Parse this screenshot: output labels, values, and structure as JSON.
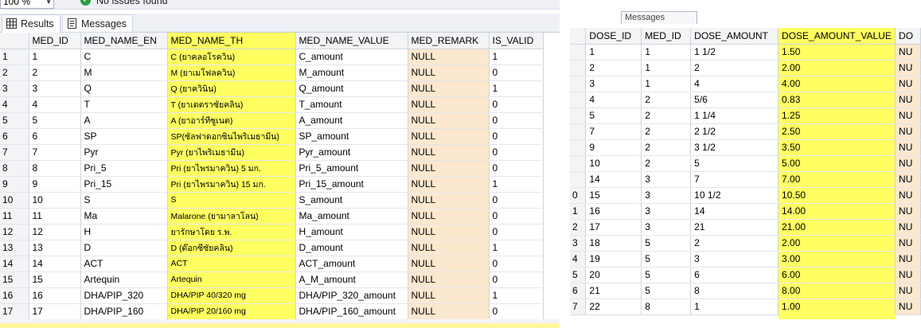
{
  "toolbar": {
    "zoom": "100 %",
    "issues": "No issues found"
  },
  "tabs": {
    "results": "Results",
    "messages": "Messages"
  },
  "left_grid": {
    "columns": [
      "MED_ID",
      "MED_NAME_EN",
      "MED_NAME_TH",
      "MED_NAME_VALUE",
      "MED_REMARK",
      "IS_VALID"
    ],
    "rows": [
      [
        "1",
        "1",
        "C",
        "C (ยาคลอโรควิน)",
        "C_amount",
        "NULL",
        "1"
      ],
      [
        "2",
        "2",
        "M",
        "M (ยาเมโฟลควิน)",
        "M_amount",
        "NULL",
        "0"
      ],
      [
        "3",
        "3",
        "Q",
        "Q (ยาควินิน)",
        "Q_amount",
        "NULL",
        "1"
      ],
      [
        "4",
        "4",
        "T",
        "T (ยาเตตราซัยคลิน)",
        "T_amount",
        "NULL",
        "0"
      ],
      [
        "5",
        "5",
        "A",
        "A (ยาอาร์ทีซูเนต)",
        "A_amount",
        "NULL",
        "0"
      ],
      [
        "6",
        "6",
        "SP",
        "SP(ซัลฟาดอกซินไพริเมธามีน)",
        "SP_amount",
        "NULL",
        "0"
      ],
      [
        "7",
        "7",
        "Pyr",
        "Pyr (ยาไพริเมธามีน)",
        "Pyr_amount",
        "NULL",
        "0"
      ],
      [
        "8",
        "8",
        "Pri_5",
        "Pri (ยาไพรมาควิน)  5 มก.",
        "Pri_5_amount",
        "NULL",
        "0"
      ],
      [
        "9",
        "9",
        "Pri_15",
        "Pri (ยาไพรมาควิน) 15 มก.",
        "Pri_15_amount",
        "NULL",
        "1"
      ],
      [
        "10",
        "10",
        "S",
        "S",
        "S_amount",
        "NULL",
        "0"
      ],
      [
        "11",
        "11",
        "Ma",
        "Malarone (ยามาลาโลน)",
        "Ma_amount",
        "NULL",
        "0"
      ],
      [
        "12",
        "12",
        "H",
        "ยารักษาโดย ร.พ.",
        "H_amount",
        "NULL",
        "0"
      ],
      [
        "13",
        "13",
        "D",
        "D (ด๊อกซีซัยคลิน)",
        "D_amount",
        "NULL",
        "1"
      ],
      [
        "14",
        "14",
        "ACT",
        "ACT",
        "ACT_amount",
        "NULL",
        "0"
      ],
      [
        "15",
        "15",
        "Artequin",
        "Artequin",
        "A_M_amount",
        "NULL",
        "0"
      ],
      [
        "16",
        "16",
        "DHA/PIP_320",
        "DHA/PIP 40/320 mg",
        "DHA/PIP_320_amount",
        "NULL",
        "1"
      ],
      [
        "17",
        "17",
        "DHA/PIP_160",
        "DHA/PIP 20/160 mg",
        "DHA/PIP_160_amount",
        "NULL",
        "0"
      ]
    ]
  },
  "right_grid": {
    "tab_hint": "Messages",
    "columns": [
      "DOSE_ID",
      "MED_ID",
      "DOSE_AMOUNT",
      "DOSE_AMOUNT_VALUE",
      "DO"
    ],
    "rows": [
      [
        "",
        "1",
        "1",
        "1 1/2",
        "1.50",
        "NU"
      ],
      [
        "",
        "2",
        "1",
        "2",
        "2.00",
        "NU"
      ],
      [
        "",
        "3",
        "1",
        "4",
        "4.00",
        "NU"
      ],
      [
        "",
        "4",
        "2",
        "5/6",
        "0.83",
        "NU"
      ],
      [
        "",
        "5",
        "2",
        "1 1/4",
        "1.25",
        "NU"
      ],
      [
        "",
        "7",
        "2",
        "2 1/2",
        "2.50",
        "NU"
      ],
      [
        "",
        "9",
        "2",
        "3 1/2",
        "3.50",
        "NU"
      ],
      [
        "",
        "10",
        "2",
        "5",
        "5.00",
        "NU"
      ],
      [
        "",
        "14",
        "3",
        "7",
        "7.00",
        "NU"
      ],
      [
        "0",
        "15",
        "3",
        "10 1/2",
        "10.50",
        "NU"
      ],
      [
        "1",
        "16",
        "3",
        "14",
        "14.00",
        "NU"
      ],
      [
        "2",
        "17",
        "3",
        "21",
        "21.00",
        "NU"
      ],
      [
        "3",
        "18",
        "5",
        "2",
        "2.00",
        "NU"
      ],
      [
        "4",
        "19",
        "5",
        "3",
        "3.00",
        "NU"
      ],
      [
        "5",
        "20",
        "5",
        "6",
        "6.00",
        "NU"
      ],
      [
        "6",
        "21",
        "5",
        "8",
        "8.00",
        "NU"
      ],
      [
        "7",
        "22",
        "8",
        "1",
        "1.00",
        "NU"
      ]
    ]
  },
  "colors": {
    "highlight": "#ffff62",
    "null_cell": "#fce8cf",
    "header": "#f3f4f6",
    "ok": "#2d9b46"
  }
}
